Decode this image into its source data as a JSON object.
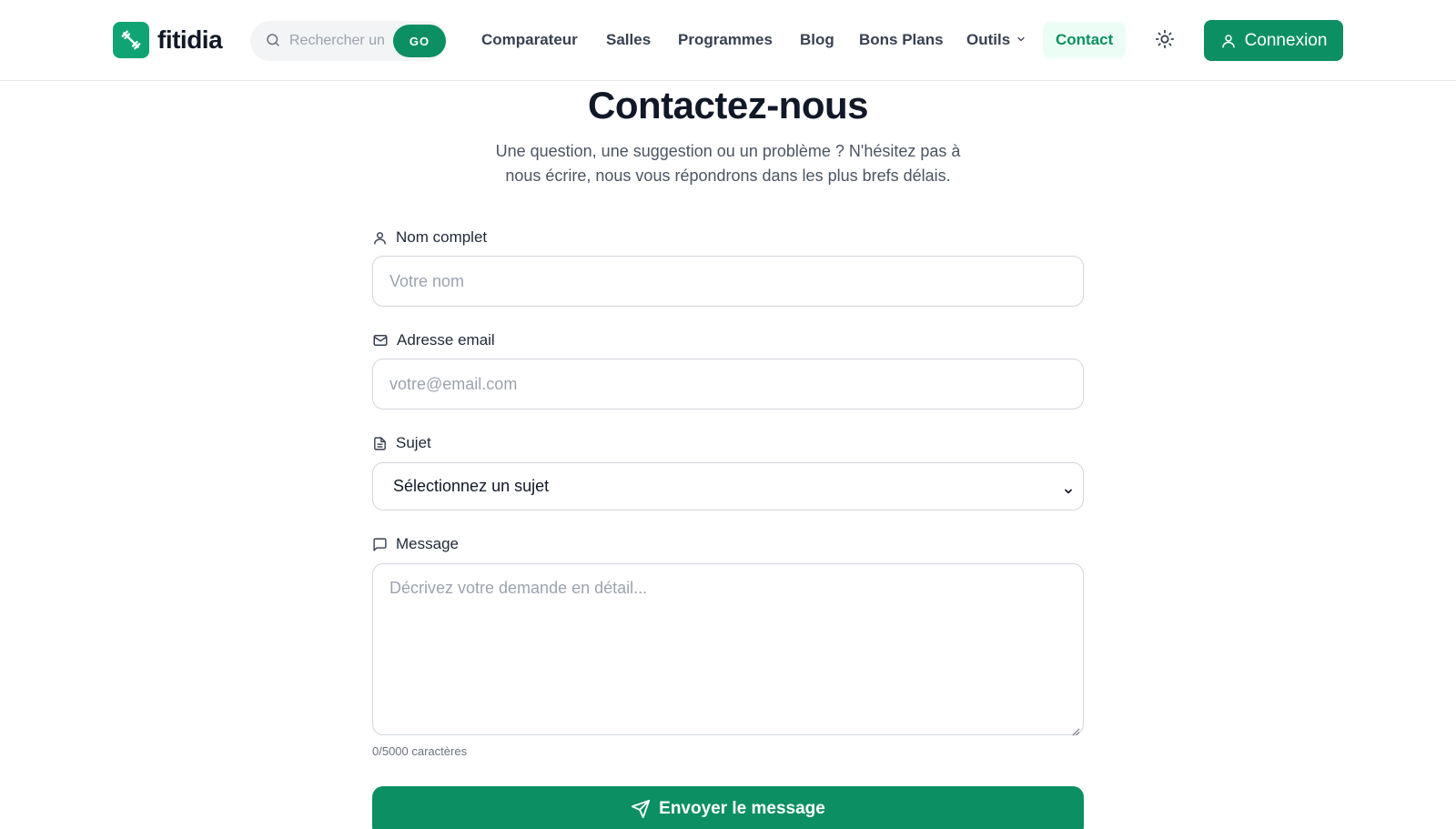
{
  "brand": {
    "name": "fitidia",
    "accent": "#0b8f63",
    "logo_icon": "dumbbell-icon"
  },
  "search": {
    "placeholder": "Rechercher un",
    "go_label": "GO"
  },
  "nav": {
    "items": [
      {
        "label": "Comparateur"
      },
      {
        "label": "Salles"
      },
      {
        "label": "Programmes"
      },
      {
        "label": "Blog"
      },
      {
        "label": "Bons Plans"
      },
      {
        "label": "Outils"
      },
      {
        "label": "Contact"
      }
    ],
    "active": "Contact"
  },
  "header": {
    "theme_icon": "sun-icon",
    "login_label": "Connexion"
  },
  "page": {
    "title": "Contactez-nous",
    "subtitle_line1": "Une question, une suggestion ou un problème ? N'hésitez pas à",
    "subtitle_line2": "nous écrire, nous vous répondrons dans les plus brefs délais."
  },
  "form": {
    "name": {
      "label": "Nom complet",
      "placeholder": "Votre nom",
      "value": ""
    },
    "email": {
      "label": "Adresse email",
      "placeholder": "votre@email.com",
      "value": ""
    },
    "subject": {
      "label": "Sujet",
      "selected": "Sélectionnez un sujet"
    },
    "message": {
      "label": "Message",
      "placeholder": "Décrivez votre demande en détail...",
      "value": ""
    },
    "char_count": "0/5000 caractères",
    "submit_label": "Envoyer le message"
  }
}
